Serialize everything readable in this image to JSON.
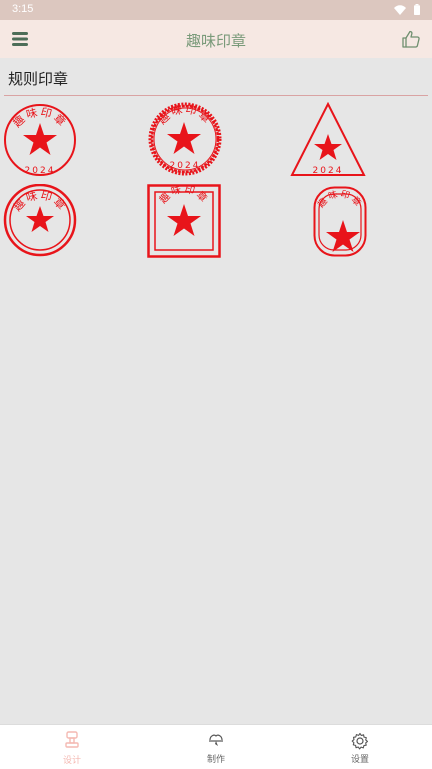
{
  "status": {
    "time": "3:15"
  },
  "app": {
    "title": "趣味印章"
  },
  "section": {
    "title": "规则印章"
  },
  "seal": {
    "text": "趣味印章",
    "year": "2024",
    "color": "#e8141a"
  },
  "nav": {
    "items": [
      {
        "label": "设计",
        "icon": "seal-stamp-icon",
        "active": true
      },
      {
        "label": "制作",
        "icon": "make-icon",
        "active": false
      },
      {
        "label": "设置",
        "icon": "gear-icon",
        "active": false
      }
    ]
  },
  "colors": {
    "accent": "#7a9a7a",
    "seal": "#e8141a",
    "nav_active": "#f4b9b2"
  }
}
